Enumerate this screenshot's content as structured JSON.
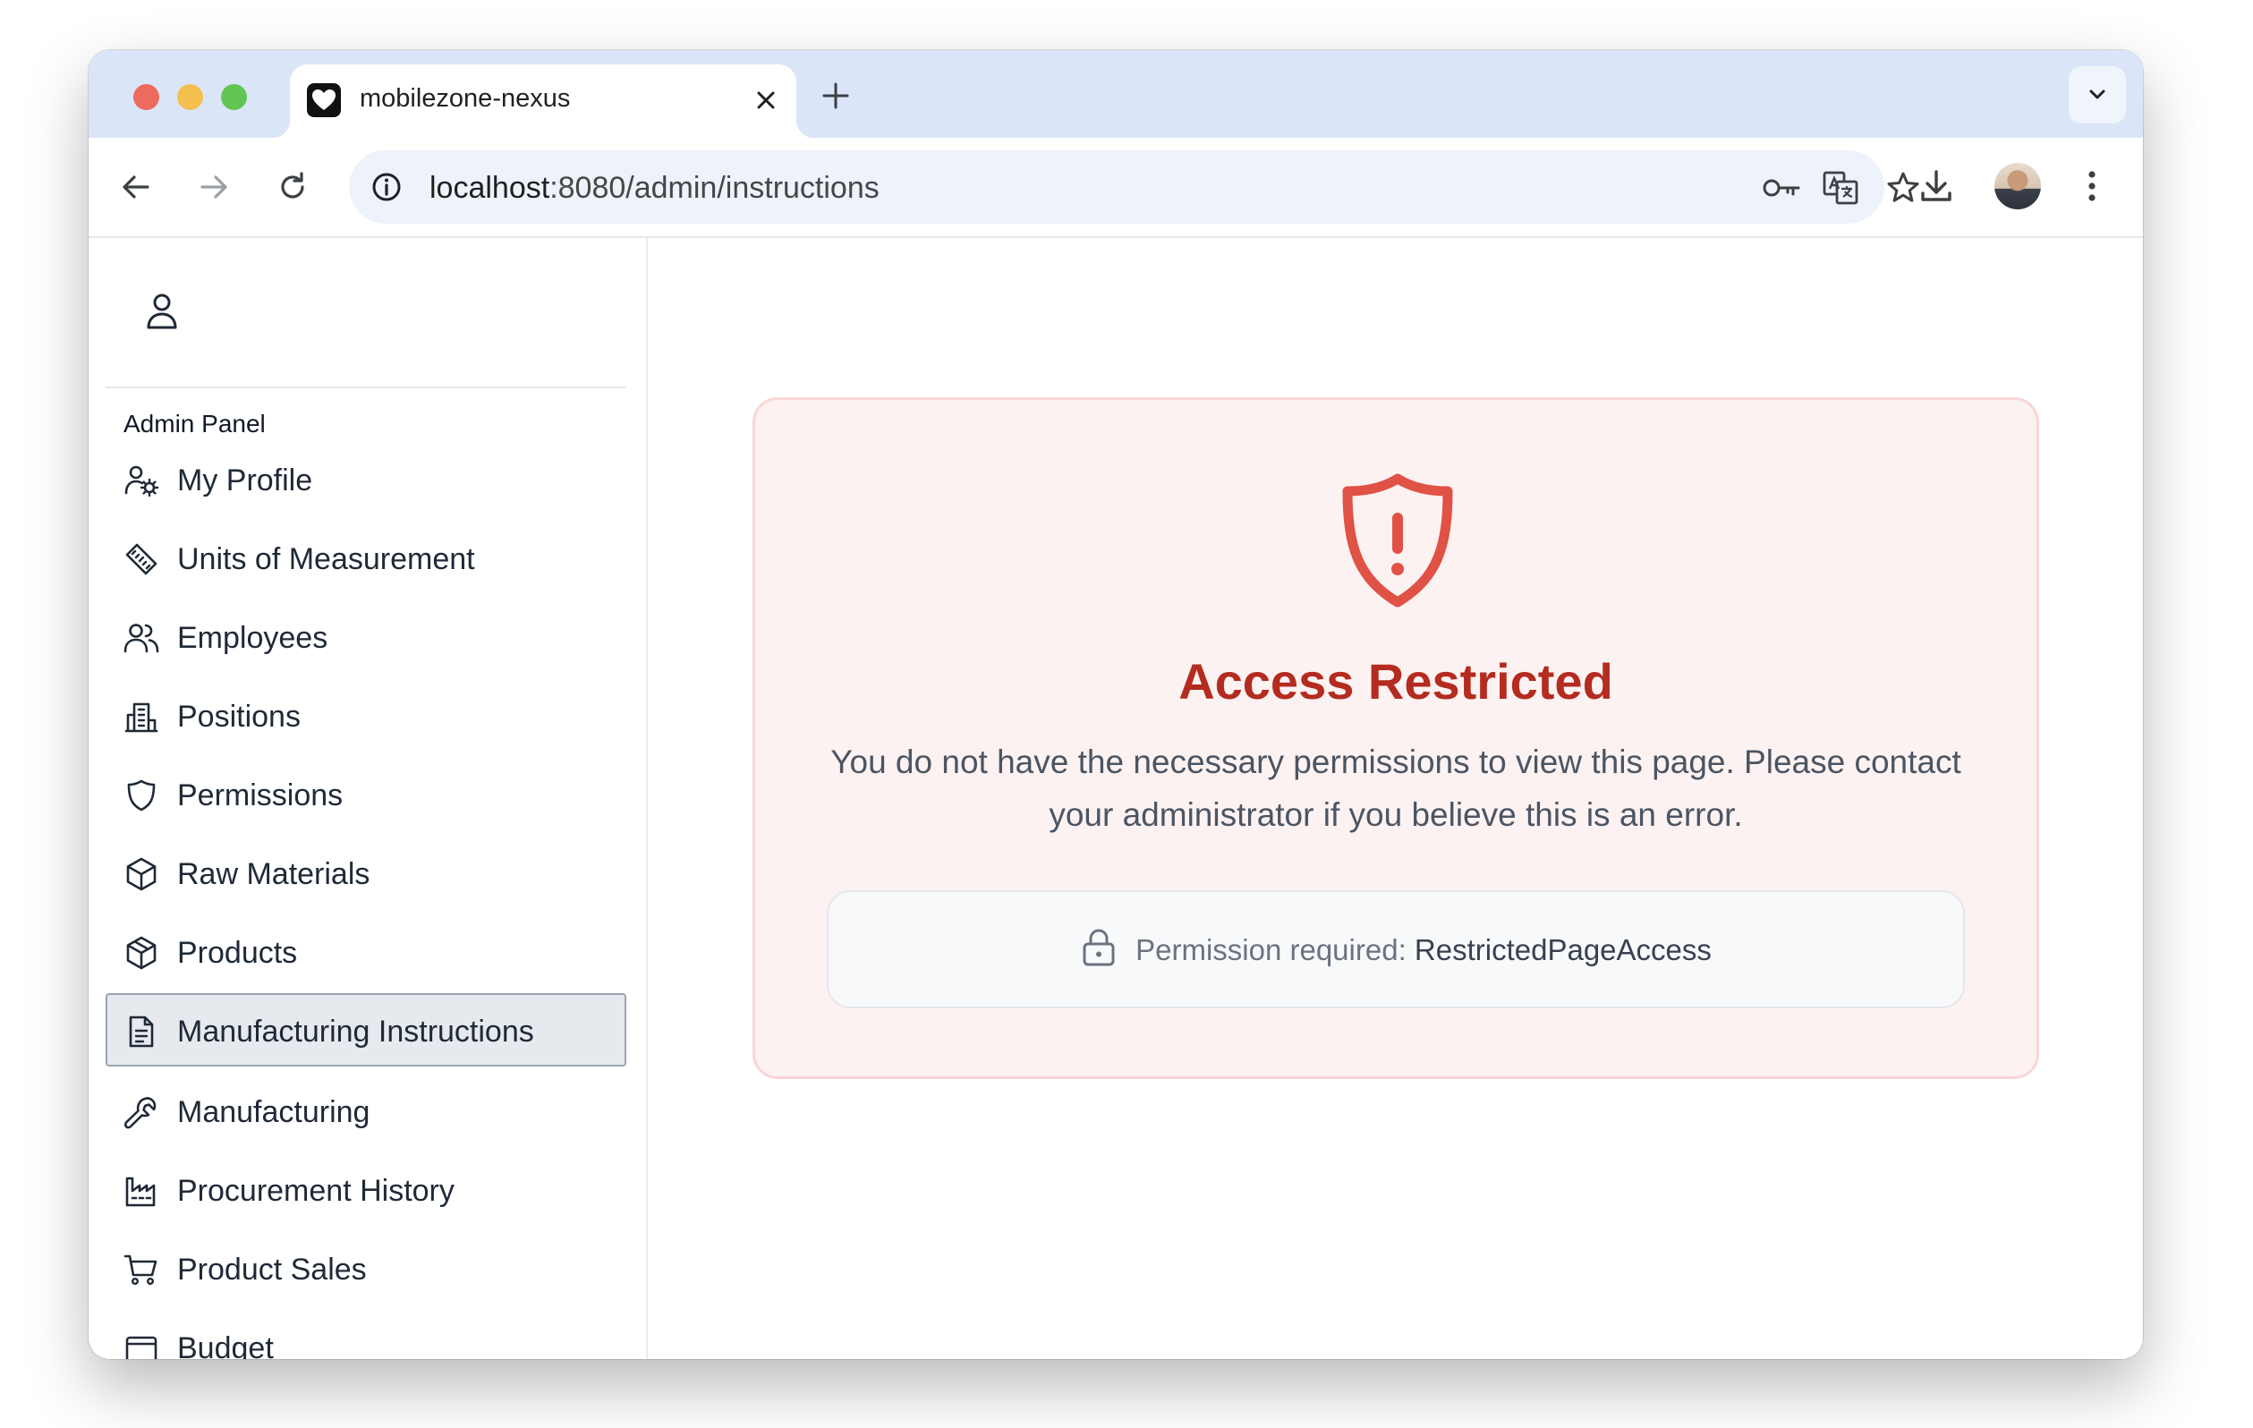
{
  "browser": {
    "tab_title": "mobilezone-nexus",
    "url_host": "localhost",
    "url_path": ":8080/admin/instructions"
  },
  "sidebar": {
    "heading": "Admin Panel",
    "items": [
      {
        "label": "My Profile",
        "icon": "user-gear-icon"
      },
      {
        "label": "Units of Measurement",
        "icon": "ruler-icon"
      },
      {
        "label": "Employees",
        "icon": "users-icon"
      },
      {
        "label": "Positions",
        "icon": "building-icon"
      },
      {
        "label": "Permissions",
        "icon": "shield-icon"
      },
      {
        "label": "Raw Materials",
        "icon": "cube-icon"
      },
      {
        "label": "Products",
        "icon": "package-icon"
      },
      {
        "label": "Manufacturing Instructions",
        "icon": "document-icon",
        "active": true
      },
      {
        "label": "Manufacturing",
        "icon": "wrench-icon"
      },
      {
        "label": "Procurement History",
        "icon": "factory-icon"
      },
      {
        "label": "Product Sales",
        "icon": "cart-icon"
      },
      {
        "label": "Budget",
        "icon": "wallet-icon"
      }
    ]
  },
  "alert": {
    "title": "Access Restricted",
    "message": "You do not have the necessary permissions to view this page. Please contact your administrator if you believe this is an error.",
    "permission_label": "Permission required:",
    "permission_name": "RestrictedPageAccess",
    "accent_color": "#b42b20"
  }
}
